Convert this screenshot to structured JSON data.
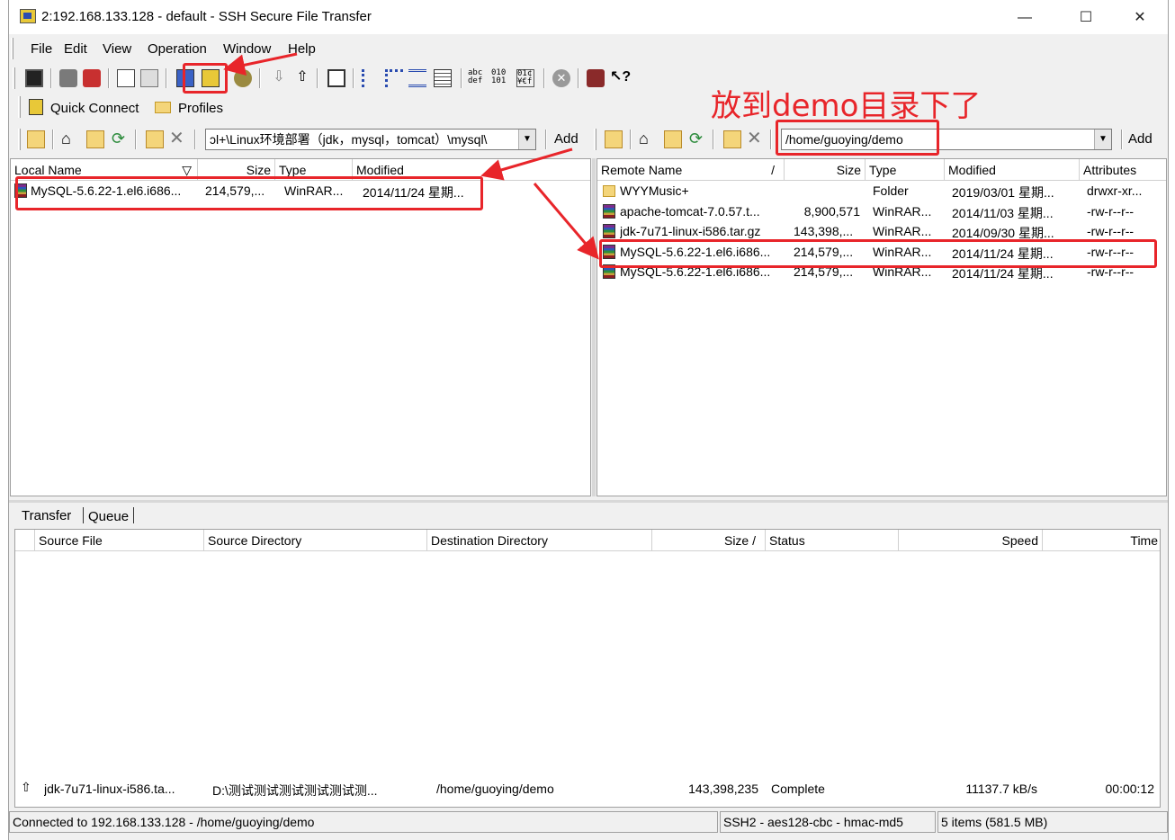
{
  "window": {
    "title": "2:192.168.133.128 - default - SSH Secure File Transfer",
    "minimize": "—",
    "maximize": "☐",
    "close": "✕"
  },
  "menu": [
    "File",
    "Edit",
    "View",
    "Operation",
    "Window",
    "Help"
  ],
  "quick": {
    "connect": "Quick Connect",
    "profiles": "Profiles"
  },
  "local": {
    "path": "ɔl+\\Linux环境部署（jdk，mysql，tomcat）\\mysql\\",
    "add": "Add",
    "headers": [
      "Local Name",
      "Size",
      "Type",
      "Modified"
    ],
    "sort_glyph": "▽",
    "rows": [
      {
        "name": "MySQL-5.6.22-1.el6.i686...",
        "size": "214,579,...",
        "type": "WinRAR...",
        "modified": "2014/11/24 星期..."
      }
    ]
  },
  "remote": {
    "path": "/home/guoying/demo",
    "add": "Add",
    "headers": [
      "Remote Name",
      "Size",
      "Type",
      "Modified",
      "Attributes"
    ],
    "sort_glyph": "/",
    "rows": [
      {
        "icon": "folder",
        "name": "WYYMusic+",
        "size": "",
        "type": "Folder",
        "modified": "2019/03/01 星期...",
        "attr": "drwxr-xr..."
      },
      {
        "icon": "rar",
        "name": "apache-tomcat-7.0.57.t...",
        "size": "8,900,571",
        "type": "WinRAR...",
        "modified": "2014/11/03 星期...",
        "attr": "-rw-r--r--"
      },
      {
        "icon": "rar",
        "name": "jdk-7u71-linux-i586.tar.gz",
        "size": "143,398,...",
        "type": "WinRAR...",
        "modified": "2014/09/30 星期...",
        "attr": "-rw-r--r--"
      },
      {
        "icon": "rar",
        "name": "MySQL-5.6.22-1.el6.i686...",
        "size": "214,579,...",
        "type": "WinRAR...",
        "modified": "2014/11/24 星期...",
        "attr": "-rw-r--r--"
      },
      {
        "icon": "rar",
        "name": "MySQL-5.6.22-1.el6.i686...",
        "size": "214,579,...",
        "type": "WinRAR...",
        "modified": "2014/11/24 星期...",
        "attr": "-rw-r--r--"
      }
    ]
  },
  "annotation": "放到demo目录下了",
  "transfer": {
    "tabs": [
      "Transfer",
      "Queue"
    ],
    "headers": [
      "Source File",
      "Source Directory",
      "Destination Directory",
      "Size",
      "Status",
      "Speed",
      "Time"
    ],
    "size_sort_glyph": "/",
    "rows": [
      {
        "arrow": "⇧",
        "file": "jdk-7u71-linux-i586.ta...",
        "src": "D:\\测试测试测试测试测试测...",
        "dst": "/home/guoying/demo",
        "size": "143,398,235",
        "status": "Complete",
        "speed": "11137.7 kB/s",
        "time": "00:00:12"
      }
    ]
  },
  "statusbar": {
    "connection": "Connected to 192.168.133.128 - /home/guoying/demo",
    "cipher": "SSH2 - aes128-cbc - hmac-md5",
    "items": "5 items (581.5 MB)"
  },
  "colors": {
    "annotation_red": "#e8252a",
    "window_bg": "#f0f0f0"
  }
}
